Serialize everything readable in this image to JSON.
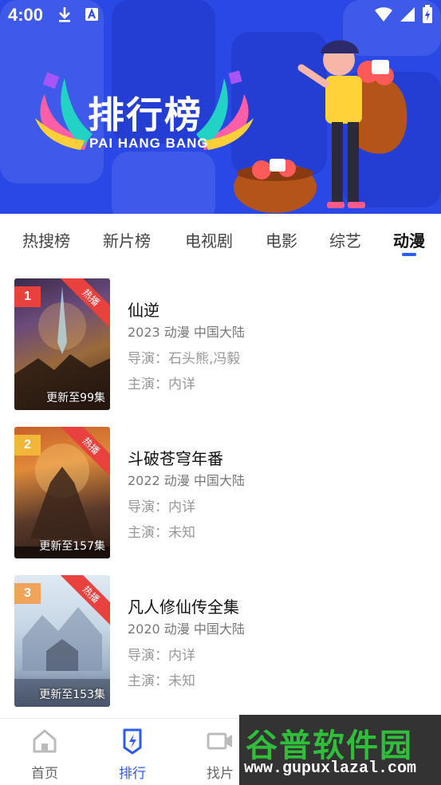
{
  "status_bar": {
    "time": "4:00"
  },
  "banner": {
    "title_cn": "排行榜",
    "title_en": "PAI HANG BANG"
  },
  "tabs": [
    {
      "label": "热搜榜"
    },
    {
      "label": "新片榜"
    },
    {
      "label": "电视剧"
    },
    {
      "label": "电影"
    },
    {
      "label": "综艺"
    },
    {
      "label": "动漫",
      "active": true
    }
  ],
  "items": [
    {
      "rank": "1",
      "rank_color": "#e8413e",
      "hot_badge": "热播",
      "update": "更新至99集",
      "title": "仙逆",
      "meta": "2023  动漫  中国大陆",
      "director": "导演：石头熊,冯毅",
      "cast": "主演：内详"
    },
    {
      "rank": "2",
      "rank_color": "#f2b63a",
      "hot_badge": "热播",
      "update": "更新至157集",
      "title": "斗破苍穹年番",
      "meta": "2022  动漫  中国大陆",
      "director": "导演：内详",
      "cast": "主演：未知"
    },
    {
      "rank": "3",
      "rank_color": "#f0a35a",
      "hot_badge": "热播",
      "update": "更新至153集",
      "title": "凡人修仙传全集",
      "meta": "2020  动漫  中国大陆",
      "director": "导演：内详",
      "cast": "主演：未知"
    }
  ],
  "bottom_nav": [
    {
      "label": "首页",
      "icon": "home-icon"
    },
    {
      "label": "排行",
      "icon": "ranking-icon",
      "active": true
    },
    {
      "label": "找片",
      "icon": "video-icon"
    }
  ],
  "watermark": {
    "brand": "谷普软件园",
    "url": "www.gupuxlazal.com"
  },
  "colors": {
    "accent": "#2d5bf0",
    "banner": "#2a48e6",
    "hot": "#e8413e"
  }
}
